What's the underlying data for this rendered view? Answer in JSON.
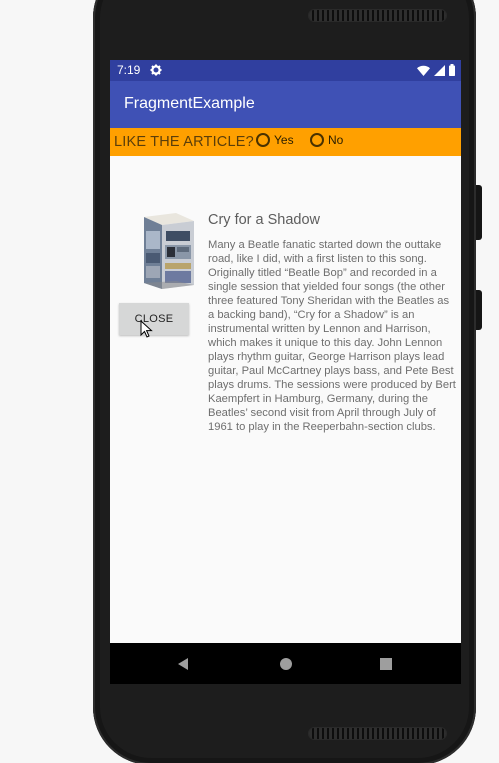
{
  "status_bar": {
    "time": "7:19",
    "icons": [
      "settings-gear-icon",
      "wifi-icon",
      "signal-icon",
      "battery-icon"
    ]
  },
  "app_bar": {
    "title": "FragmentExample",
    "color": "#3f51b5"
  },
  "rating": {
    "question": "LIKE THE ARTICLE?",
    "options": [
      {
        "label": "Yes",
        "selected": false
      },
      {
        "label": "No",
        "selected": false
      }
    ],
    "color": "#ffa000"
  },
  "article": {
    "title": "Cry for a Shadow",
    "body": "Many a Beatle fanatic started down the outtake road, like I did, with a first listen to this song. Originally titled “Beatle Bop” and recorded in a single session that yielded four songs (the other three featured Tony Sheridan with the Beatles as a backing band), “Cry for a Shadow” is an instrumental written by Lennon and Harrison, which makes it unique to this day. John Lennon plays rhythm guitar, George Harrison plays lead guitar, Paul McCartney plays bass, and Pete Best plays drums. The sessions were produced by Bert Kaempfert in Hamburg, Germany, during the Beatles’ second visit from April through July of 1961 to play in the Reeperbahn-section clubs.",
    "image": "album-box-set-image"
  },
  "actions": {
    "close_label": "CLOSE"
  },
  "nav_bar": {
    "buttons": [
      "back-icon",
      "home-icon",
      "recents-icon"
    ]
  }
}
